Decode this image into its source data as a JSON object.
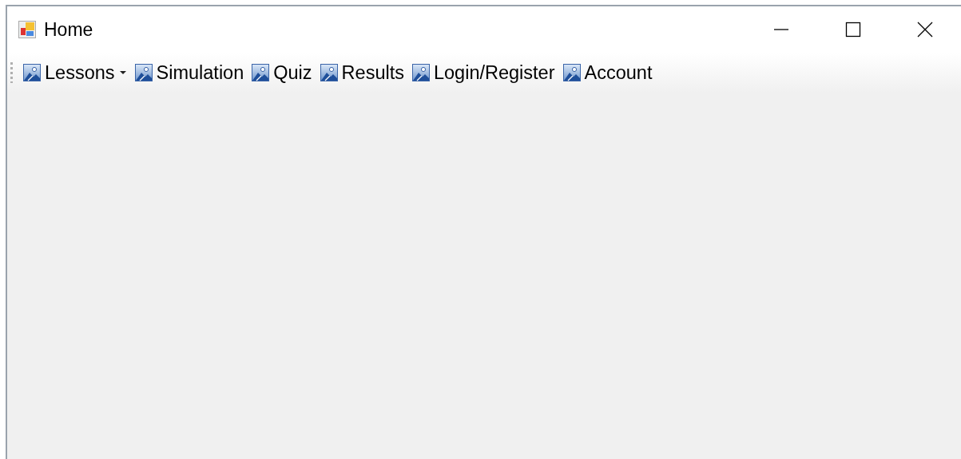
{
  "window": {
    "title": "Home"
  },
  "toolbar": {
    "items": [
      {
        "label": "Lessons",
        "dropdown": true
      },
      {
        "label": "Simulation",
        "dropdown": false
      },
      {
        "label": "Quiz",
        "dropdown": false
      },
      {
        "label": "Results",
        "dropdown": false
      },
      {
        "label": "Login/Register",
        "dropdown": false
      },
      {
        "label": "Account",
        "dropdown": false
      }
    ]
  }
}
